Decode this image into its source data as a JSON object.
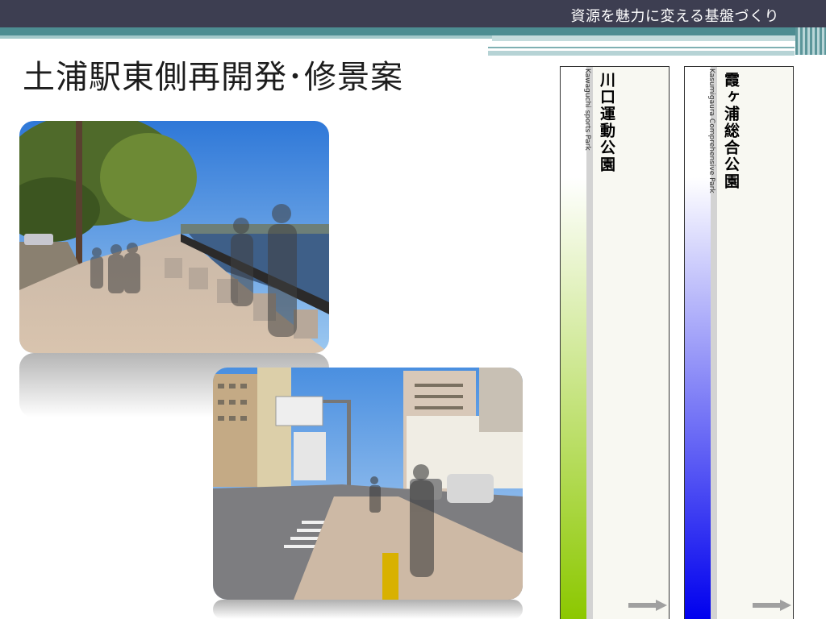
{
  "header": {
    "subtitle": "資源を魅力に変える基盤づくり"
  },
  "slide": {
    "title": "土浦駅東側再開発･修景案"
  },
  "photos": [
    {
      "subject": "lakeside promenade with silhouettes"
    },
    {
      "subject": "street crosswalk with silhouette"
    }
  ],
  "panels": [
    {
      "name_jp": "川口運動公園",
      "name_en": "Kawaguchi sports Park",
      "bar_color_top": "#ffffff",
      "bar_color_bottom": "#8cc800"
    },
    {
      "name_jp": "霞ヶ浦総合公園",
      "name_en": "Kasumigaura Comprehensive Park",
      "bar_color_top": "#ffffff",
      "bar_color_bottom": "#0000ee"
    }
  ],
  "colors": {
    "topbar": "#3d3e51",
    "teal": "#4d8d92"
  }
}
